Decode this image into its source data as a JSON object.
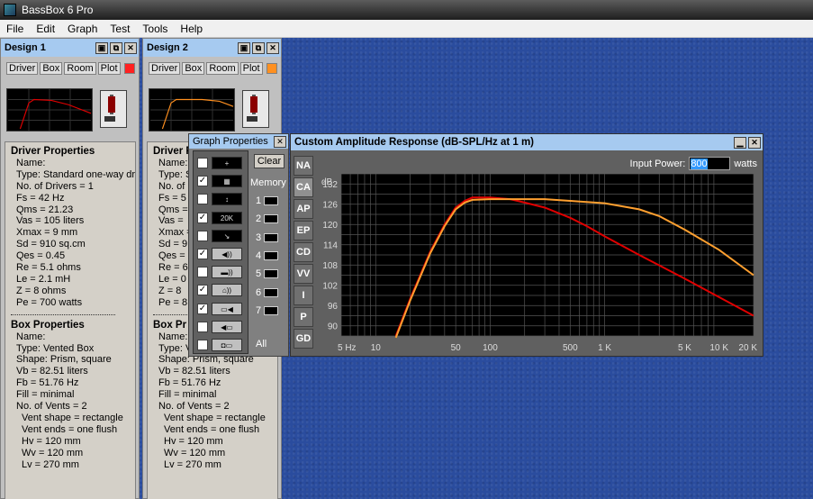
{
  "app": {
    "title": "BassBox 6 Pro"
  },
  "menu": [
    "File",
    "Edit",
    "Graph",
    "Test",
    "Tools",
    "Help"
  ],
  "window_buttons": {
    "save": "▣",
    "copy": "⧉",
    "close": "✕"
  },
  "designs": [
    {
      "title": "Design 1",
      "tabs": [
        "Driver",
        "Box",
        "Room",
        "Plot"
      ],
      "plot_color": "#ff2020",
      "driver_header": "Driver Properties",
      "driver_lines": [
        "Name:",
        "Type: Standard one-way driver",
        "No. of Drivers = 1",
        "Fs = 42 Hz",
        "Qms = 21.23",
        "Vas = 105 liters",
        "Xmax = 9 mm",
        "Sd = 910 sq.cm",
        "Qes = 0.45",
        "Re = 5.1 ohms",
        "Le = 2.1 mH",
        "Z = 8 ohms",
        "Pe = 700 watts"
      ],
      "box_header": "Box Properties",
      "box_lines": [
        "Name:",
        "Type: Vented Box",
        "Shape: Prism, square",
        "Vb = 82.51 liters",
        "Fb = 51.76 Hz",
        "Fill = minimal",
        "No. of Vents = 2"
      ],
      "vent_lines": [
        "Vent shape = rectangle",
        "Vent ends = one flush",
        "Hv = 120 mm",
        "Wv = 120 mm",
        "Lv = 270 mm"
      ]
    },
    {
      "title": "Design 2",
      "tabs": [
        "Driver",
        "Box",
        "Room",
        "Plot"
      ],
      "plot_color": "#ff9020",
      "driver_header": "Driver P",
      "driver_lines": [
        "Name:",
        "Type: S",
        "No. of",
        "Fs = 5",
        "Qms =",
        "Vas =",
        "Xmax =",
        "Sd = 9",
        "Qes =",
        "Re = 6",
        "Le = 0",
        "Z = 8",
        "Pe = 8"
      ],
      "box_header": "Box Pr",
      "box_lines": [
        "Name:",
        "Type: V",
        "Shape: Prism, square",
        "Vb = 82.51 liters",
        "Fb = 51.76 Hz",
        "Fill = minimal",
        "No. of Vents = 2"
      ],
      "vent_lines": [
        "Vent shape = rectangle",
        "Vent ends = one flush",
        "Hv = 120 mm",
        "Wv = 120 mm",
        "Lv = 270 mm"
      ]
    }
  ],
  "graph_properties": {
    "title": "Graph Properties",
    "clear_label": "Clear",
    "memory_label": "Memory",
    "memory_slots": [
      "1",
      "2",
      "3",
      "4",
      "5",
      "6",
      "7"
    ],
    "all_label": "All",
    "rows": [
      {
        "checked": false,
        "icon": "+"
      },
      {
        "checked": true,
        "icon": "▦"
      },
      {
        "checked": false,
        "icon": "↕"
      },
      {
        "checked": true,
        "icon": "20K"
      },
      {
        "checked": false,
        "icon": "↘"
      },
      {
        "checked": true,
        "icon": "◀))"
      },
      {
        "checked": false,
        "icon": "▬))"
      },
      {
        "checked": true,
        "icon": "⌂))"
      },
      {
        "checked": true,
        "icon": "▭◀"
      },
      {
        "checked": false,
        "icon": "◀▭"
      },
      {
        "checked": false,
        "icon": "◘▭"
      }
    ]
  },
  "amplitude_window": {
    "title": "Custom Amplitude Response (dB-SPL/Hz at 1 m)",
    "tabs": [
      "NA",
      "CA",
      "AP",
      "EP",
      "CD",
      "VV",
      "I",
      "P",
      "GD"
    ],
    "active_tab": "CA",
    "input_power_label": "Input Power:",
    "input_power_value": "800",
    "input_power_unit": "watts",
    "min_button": "▁",
    "close_button": "✕"
  },
  "chart_data": {
    "type": "line",
    "title": "",
    "xlabel": "",
    "ylabel": "dB",
    "xscale": "log",
    "xlim": [
      5,
      20000
    ],
    "ylim": [
      87,
      135
    ],
    "x_ticks": [
      5,
      10,
      50,
      100,
      500,
      1000,
      5000,
      10000,
      20000
    ],
    "x_tick_labels": [
      "5 Hz",
      "10",
      "50",
      "100",
      "500",
      "1 K",
      "5 K",
      "10 K",
      "20 K"
    ],
    "y_ticks": [
      90,
      96,
      102,
      108,
      114,
      120,
      126,
      132
    ],
    "y_tick_labels": [
      "90",
      "96",
      "102",
      "108",
      "114",
      "120",
      "126",
      "132"
    ],
    "grid": true,
    "background": "#000000",
    "series": [
      {
        "color": "#e00000",
        "x": [
          15,
          20,
          30,
          40,
          50,
          60,
          70,
          80,
          100,
          150,
          200,
          300,
          500,
          700,
          1000,
          2000,
          5000,
          10000,
          20000
        ],
        "y": [
          87,
          98,
          112,
          120,
          125,
          127,
          128,
          128,
          128,
          127.5,
          126.5,
          125,
          122,
          119.5,
          116.5,
          111,
          104,
          98.5,
          93
        ]
      },
      {
        "color": "#ffa030",
        "x": [
          15,
          20,
          30,
          40,
          50,
          60,
          70,
          100,
          200,
          300,
          500,
          1000,
          2000,
          3000,
          5000,
          10000,
          20000
        ],
        "y": [
          86.5,
          97.5,
          111.5,
          119.5,
          124.5,
          126.5,
          127.3,
          127.5,
          127.5,
          127.5,
          127,
          126.3,
          124.5,
          122.5,
          118.5,
          112.5,
          105
        ]
      }
    ]
  }
}
